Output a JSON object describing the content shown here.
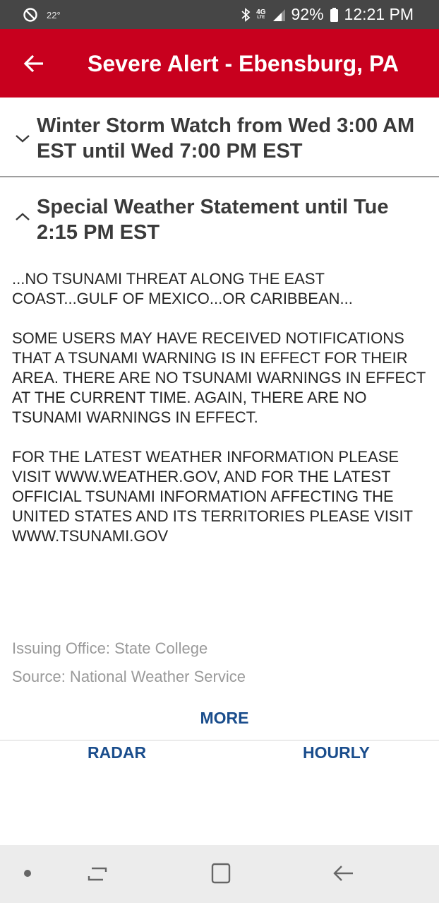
{
  "status_bar": {
    "temperature": "22°",
    "network": "4G",
    "network_sub": "LTE",
    "battery": "92%",
    "time": "12:21 PM"
  },
  "app_bar": {
    "title": "Severe Alert - Ebensburg, PA",
    "accent_color": "#c8001e"
  },
  "alerts": [
    {
      "title": "Winter Storm Watch from Wed 3:00 AM EST until Wed 7:00 PM EST",
      "expanded": false
    },
    {
      "title": "Special Weather Statement until Tue 2:15 PM EST",
      "expanded": true,
      "paragraphs": [
        "...NO TSUNAMI THREAT ALONG THE EAST COAST...GULF OF MEXICO...OR CARIBBEAN...",
        "SOME USERS MAY HAVE RECEIVED NOTIFICATIONS THAT A TSUNAMI WARNING IS IN EFFECT FOR THEIR AREA. THERE ARE NO TSUNAMI WARNINGS IN EFFECT AT THE CURRENT TIME. AGAIN, THERE ARE NO TSUNAMI WARNINGS IN EFFECT.",
        "FOR THE LATEST WEATHER INFORMATION PLEASE VISIT WWW.WEATHER.GOV, AND FOR THE LATEST OFFICIAL TSUNAMI INFORMATION AFFECTING THE UNITED STATES AND ITS TERRITORIES PLEASE VISIT WWW.TSUNAMI.GOV"
      ]
    }
  ],
  "meta": {
    "issuing_office": "Issuing Office: State College",
    "source": "Source: National Weather Service"
  },
  "actions": {
    "more_label": "MORE",
    "radar_label": "RADAR",
    "hourly_label": "HOURLY",
    "link_color": "#1a4d8c"
  },
  "icons": {
    "back": "arrow-left-icon",
    "collapsed": "chevron-down-icon",
    "expanded": "chevron-up-icon"
  }
}
